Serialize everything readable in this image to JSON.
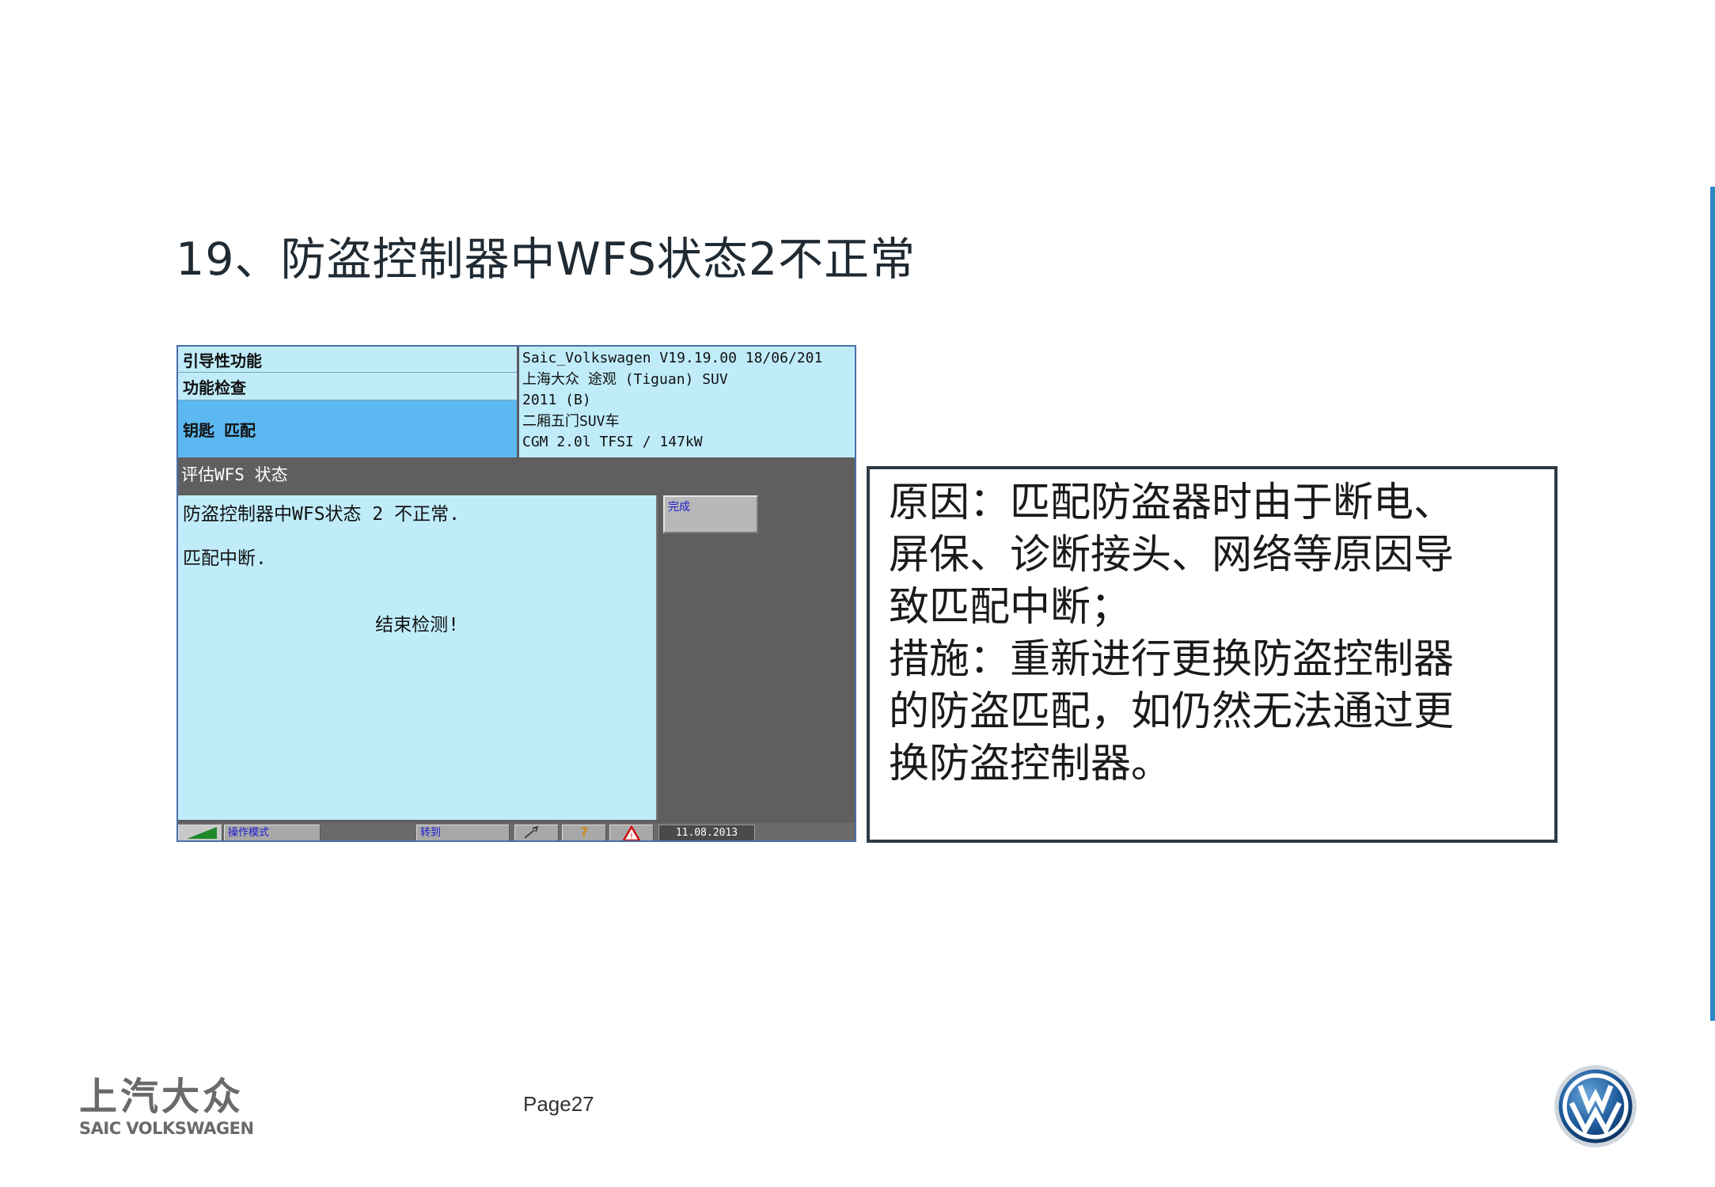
{
  "slide": {
    "title": "19、防盗控制器中WFS状态2不正常",
    "page": "Page27"
  },
  "screenshot": {
    "nav": [
      "引导性功能",
      "功能检查",
      "钥匙 匹配"
    ],
    "vehicle": [
      "Saic_Volkswagen  V19.19.00 18/06/201",
      "上海大众 途观 (Tiguan) SUV",
      "2011 (B)",
      "二厢五门SUV车",
      "CGM 2.0l TFSI  /  147kW"
    ],
    "section_title": "评估WFS 状态",
    "messages": [
      "防盗控制器中WFS状态 2 不正常.",
      "匹配中断.",
      "结束检测!"
    ],
    "done_button": "完成",
    "statusbar": {
      "mode": "操作模式",
      "goto": "转到",
      "help": "?",
      "warning": "!",
      "date": "11.08.2013"
    }
  },
  "note": {
    "lines": [
      "原因：匹配防盗器时由于断电、",
      "屏保、诊断接头、网络等原因导",
      "致匹配中断；",
      "措施：重新进行更换防盗控制器",
      "的防盗匹配，如仍然无法通过更",
      "换防盗控制器。"
    ]
  },
  "brand": {
    "cn": "上汽大众",
    "en": "SAIC VOLKSWAGEN"
  },
  "colors": {
    "accent": "#2f86c4",
    "panel_light": "#c0ecfa",
    "panel_selected": "#5cb8f0",
    "panel_dark": "#5f5f5f"
  },
  "icons": [
    "vw-logo-icon",
    "signal-icon",
    "tools-icon",
    "help-icon",
    "warning-icon"
  ]
}
